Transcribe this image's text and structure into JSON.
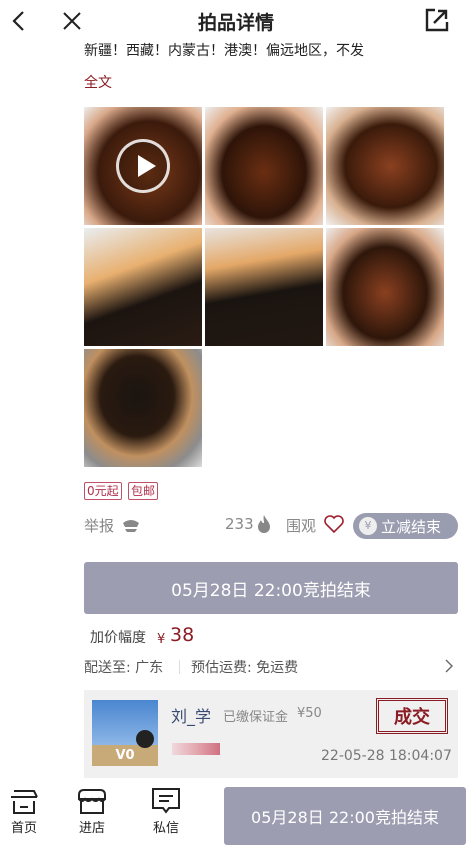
{
  "header": {
    "title": "拍品详情"
  },
  "description": {
    "text": "新疆！西藏！内蒙古！港澳！偏远地区，不发",
    "more_label": "全文"
  },
  "photos": [
    {
      "video": true
    },
    {
      "video": false
    },
    {
      "video": false
    },
    {
      "video": false
    },
    {
      "video": false
    },
    {
      "video": false
    },
    {
      "video": false
    }
  ],
  "tags": [
    "0元起",
    "包邮"
  ],
  "actions": {
    "report_label": "举报",
    "heat_count": "233",
    "watch_label": "围观",
    "discount_label": "立减结束"
  },
  "auction_button": "05月28日 22:00竞拍结束",
  "increment": {
    "label": "加价幅度",
    "currency": "¥",
    "value": "38"
  },
  "shipping": {
    "to_label": "配送至: 广东",
    "fee_label": "预估运费: 免运费"
  },
  "bidder": {
    "name": "刘_学",
    "deposit_label": "已缴保证金",
    "deposit_value": "¥50",
    "level": "V0",
    "status": "成交",
    "time": "22-05-28 18:04:07"
  },
  "bottom_nav": [
    {
      "label": "首页"
    },
    {
      "label": "进店"
    },
    {
      "label": "私信"
    }
  ],
  "bottom_button": "05月28日 22:00竞拍结束",
  "colors": {
    "accent": "#8a1c24",
    "button": "#9c9db0"
  }
}
